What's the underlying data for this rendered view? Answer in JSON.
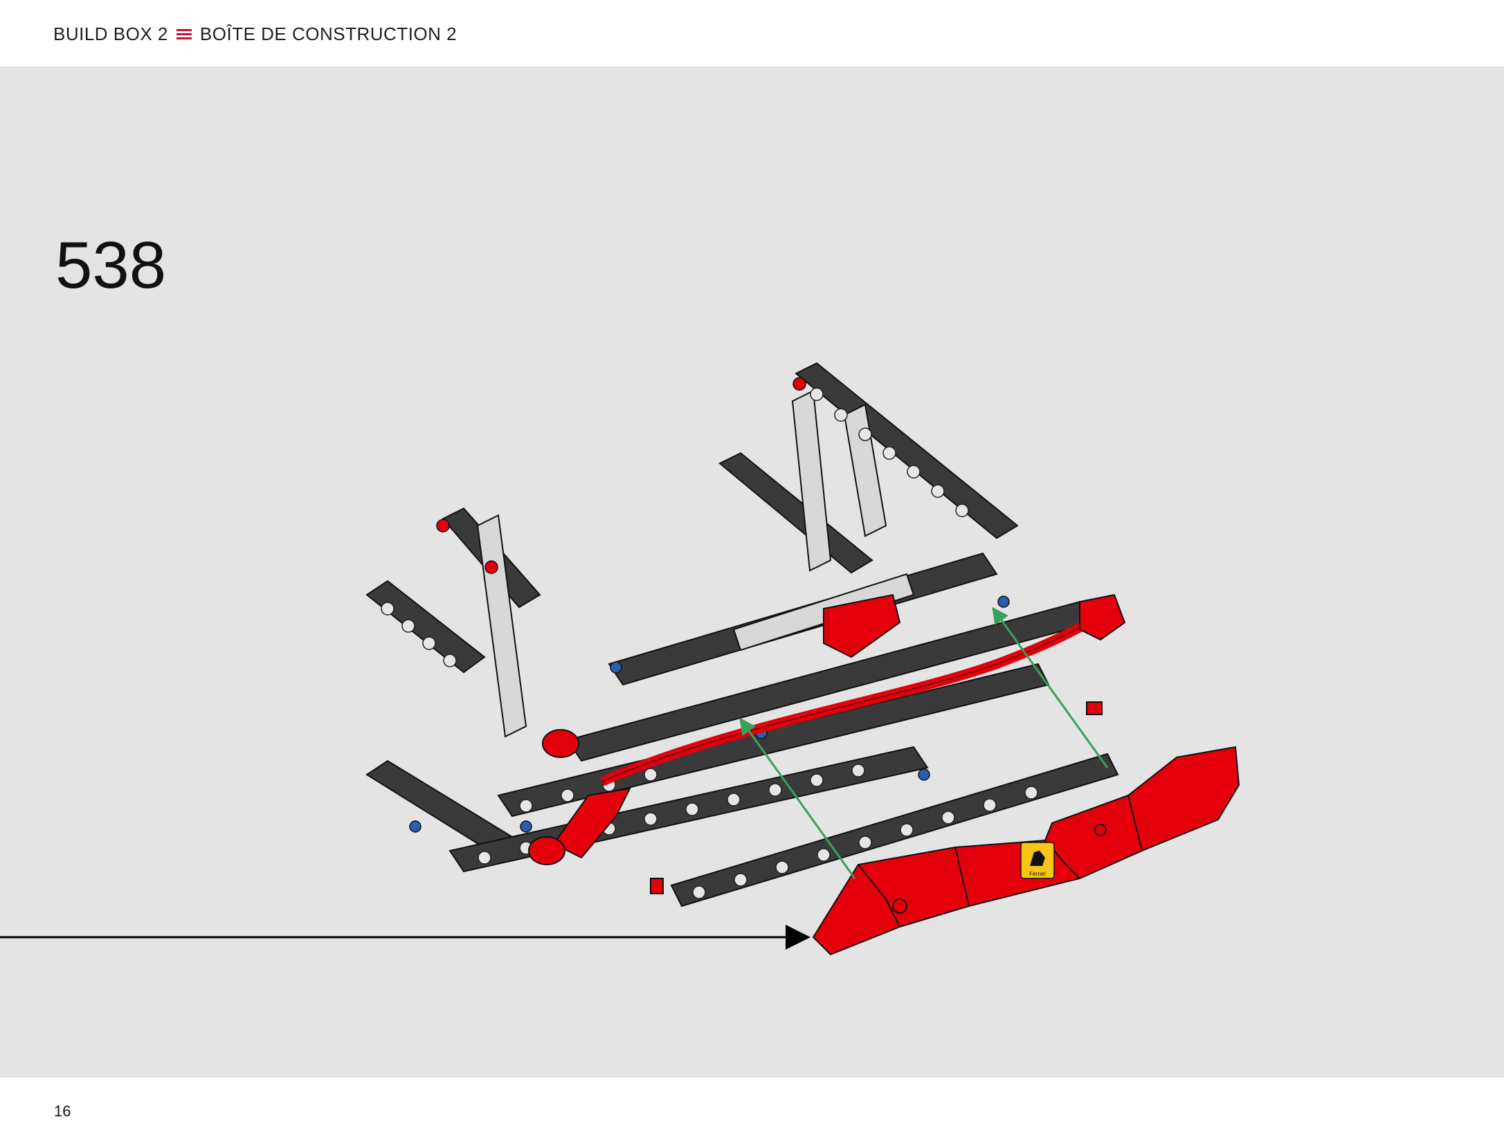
{
  "header": {
    "left_label": "BUILD BOX 2",
    "separator_icon": "three-line-icon",
    "right_label": "BOÎTE DE CONSTRUCTION 2",
    "accent_color": "#c8102e"
  },
  "step": {
    "number": "538"
  },
  "illustration": {
    "badge_text": "Ferrari",
    "part_color": "#e3000b",
    "frame_color": "#3a3a3a",
    "guide_arrow_color": "#3aa05a"
  },
  "footer": {
    "page_number": "16"
  }
}
